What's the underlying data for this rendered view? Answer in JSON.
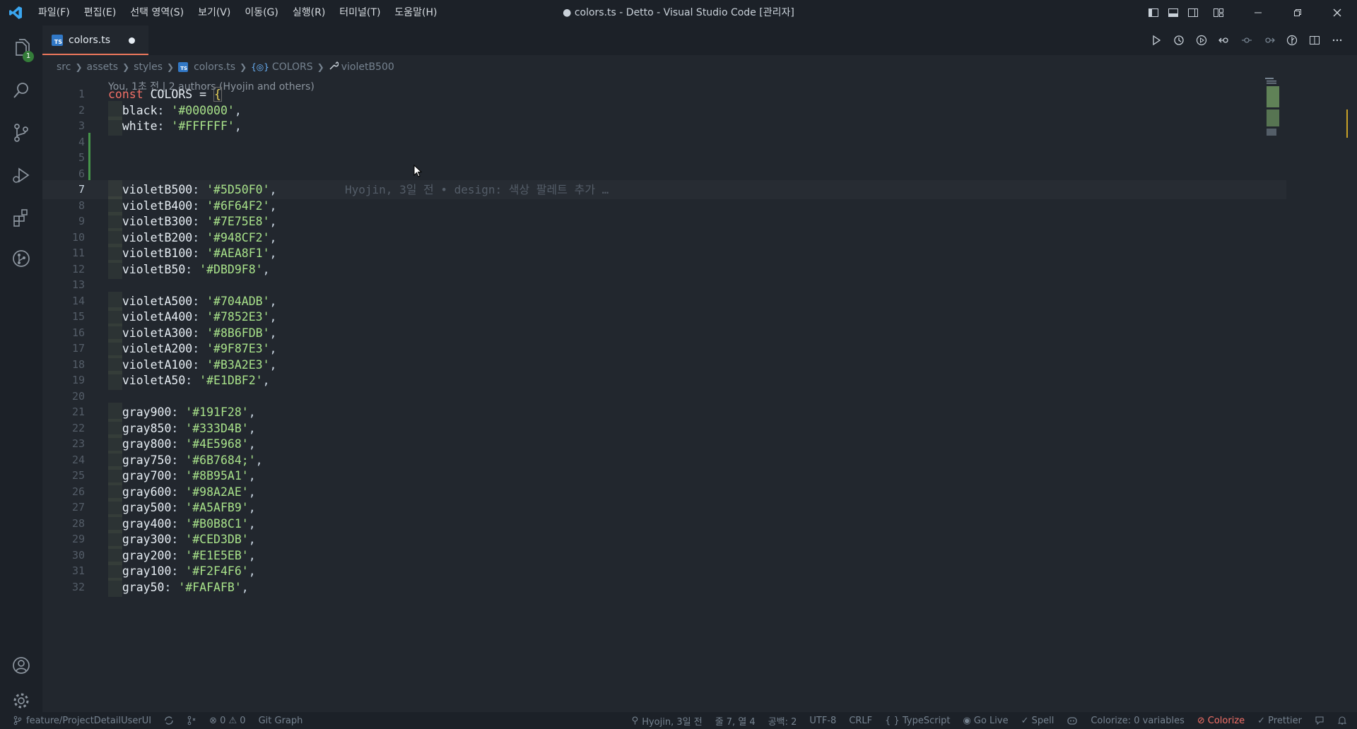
{
  "menu": [
    "파일(F)",
    "편집(E)",
    "선택 영역(S)",
    "보기(V)",
    "이동(G)",
    "실행(R)",
    "터미널(T)",
    "도움말(H)"
  ],
  "window_title": "● colors.ts - Detto - Visual Studio Code [관리자]",
  "activity": {
    "explorer_badge": "1"
  },
  "tab": {
    "label": "colors.ts",
    "icon_text": "TS"
  },
  "breadcrumb": {
    "src": "src",
    "assets": "assets",
    "styles": "styles",
    "file": "colors.ts",
    "object": "COLORS",
    "property": "violetB500"
  },
  "codelens": "You, 1초 전 | 2 authors (Hyojin and others)",
  "code": {
    "line1": {
      "kw": "const",
      "name": " COLORS = ",
      "brace": "{"
    },
    "props": [
      {
        "n": "2",
        "key": "black",
        "val": "'#000000'"
      },
      {
        "n": "3",
        "key": "white",
        "val": "'#FFFFFF'"
      },
      {
        "n": "7",
        "key": "violetB500",
        "val": "'#5D50F0'"
      },
      {
        "n": "8",
        "key": "violetB400",
        "val": "'#6F64F2'"
      },
      {
        "n": "9",
        "key": "violetB300",
        "val": "'#7E75E8'"
      },
      {
        "n": "10",
        "key": "violetB200",
        "val": "'#948CF2'"
      },
      {
        "n": "11",
        "key": "violetB100",
        "val": "'#AEA8F1'"
      },
      {
        "n": "12",
        "key": "violetB50",
        "val": "'#DBD9F8'"
      },
      {
        "n": "14",
        "key": "violetA500",
        "val": "'#704ADB'"
      },
      {
        "n": "15",
        "key": "violetA400",
        "val": "'#7852E3'"
      },
      {
        "n": "16",
        "key": "violetA300",
        "val": "'#8B6FDB'"
      },
      {
        "n": "17",
        "key": "violetA200",
        "val": "'#9F87E3'"
      },
      {
        "n": "18",
        "key": "violetA100",
        "val": "'#B3A2E3'"
      },
      {
        "n": "19",
        "key": "violetA50",
        "val": "'#E1DBF2'"
      },
      {
        "n": "21",
        "key": "gray900",
        "val": "'#191F28'"
      },
      {
        "n": "22",
        "key": "gray850",
        "val": "'#333D4B'"
      },
      {
        "n": "23",
        "key": "gray800",
        "val": "'#4E5968'"
      },
      {
        "n": "24",
        "key": "gray750",
        "val": "'#6B7684;'"
      },
      {
        "n": "25",
        "key": "gray700",
        "val": "'#8B95A1'"
      },
      {
        "n": "26",
        "key": "gray600",
        "val": "'#98A2AE'"
      },
      {
        "n": "27",
        "key": "gray500",
        "val": "'#A5AFB9'"
      },
      {
        "n": "28",
        "key": "gray400",
        "val": "'#B0B8C1'"
      },
      {
        "n": "29",
        "key": "gray300",
        "val": "'#CED3DB'"
      },
      {
        "n": "30",
        "key": "gray200",
        "val": "'#E1E5EB'"
      },
      {
        "n": "31",
        "key": "gray100",
        "val": "'#F2F4F6'"
      },
      {
        "n": "32",
        "key": "gray50",
        "val": "'#FAFAFB'"
      }
    ],
    "empty_lines": [
      "4",
      "5",
      "6",
      "13",
      "20"
    ],
    "blame": "Hyojin, 3일 전 • design: 색상 팔레트 추가 …"
  },
  "status": {
    "branch": "feature/ProjectDetailUserUI",
    "problems": "⊗ 0 ⚠ 0",
    "git_graph": "Git Graph",
    "blame": "Hyojin, 3일 전",
    "position": "줄 7, 열 4",
    "spaces": "공백: 2",
    "encoding": "UTF-8",
    "eol": "CRLF",
    "language": "{ } TypeScript",
    "golive": "Go Live",
    "spell": "✓ Spell",
    "colorize_vars": "Colorize: 0 variables",
    "colorize": "Colorize",
    "prettier": "✓ Prettier"
  }
}
